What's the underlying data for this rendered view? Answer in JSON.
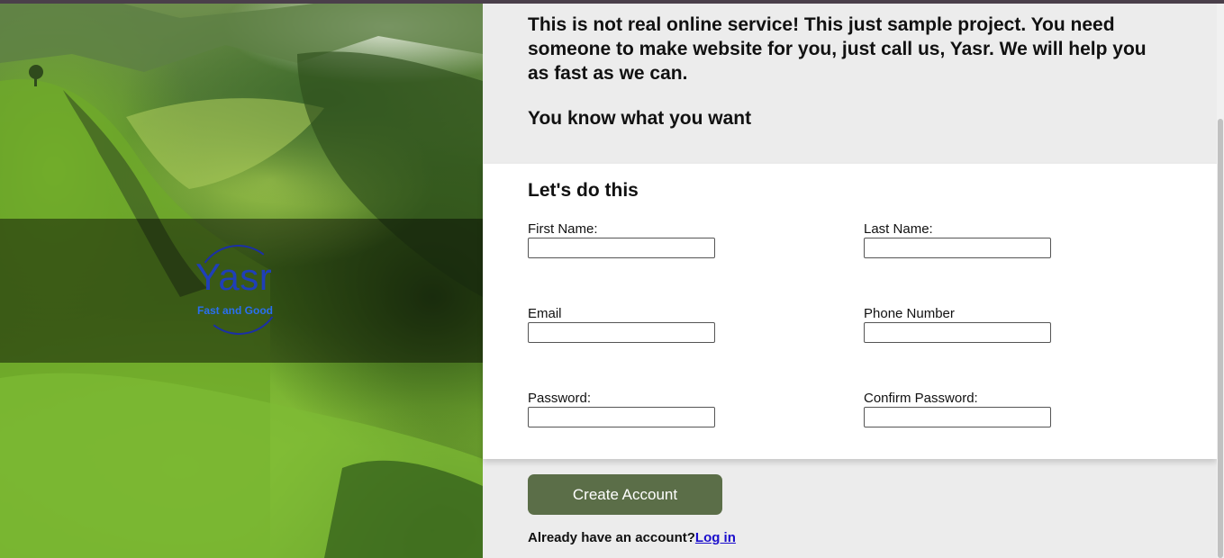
{
  "brand": {
    "name": "Yasr",
    "tagline": "Fast and Good"
  },
  "intro": {
    "message": "This is not real online service! This just sample project. You need someone to make website for you, just call us, Yasr. We will help you as fast as we can.",
    "heading": "You know what you want"
  },
  "form": {
    "title": "Let's do this",
    "first_name_label": "First Name:",
    "last_name_label": "Last Name:",
    "email_label": "Email",
    "phone_label": "Phone Number",
    "password_label": "Password:",
    "confirm_password_label": "Confirm Password:",
    "first_name_value": "",
    "last_name_value": "",
    "email_value": "",
    "phone_value": "",
    "password_value": "",
    "confirm_password_value": "",
    "submit_label": "Create Account"
  },
  "footer": {
    "already_text": "Already have an account?",
    "login_link": "Log in"
  },
  "colors": {
    "button": "#5b6e48",
    "link": "#1a0dcc",
    "logo": "#1f3fb8",
    "tagline": "#2a6ff0"
  }
}
